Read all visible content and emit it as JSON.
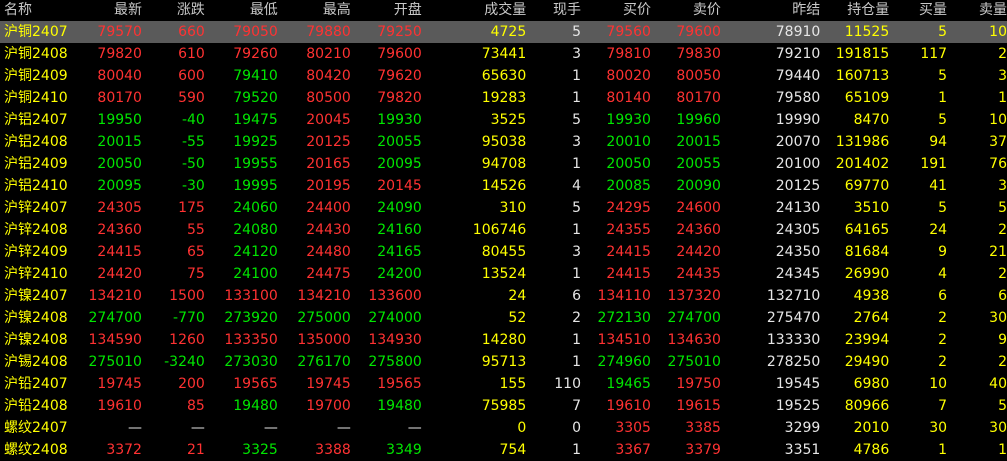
{
  "headers": [
    "名称",
    "最新",
    "涨跌",
    "最低",
    "最高",
    "开盘",
    "成交量",
    "现手",
    "买价",
    "卖价",
    "昨结",
    "持仓量",
    "买量",
    "卖量"
  ],
  "colors": {
    "up": "#ff3232",
    "down": "#00e600",
    "flat": "#e6e6e6",
    "volume": "#ffff00",
    "selected_row_bg": "#5a5a5a"
  },
  "rows": [
    {
      "name": "沪铜2407",
      "last": "79570",
      "chg": "660",
      "low": "79050",
      "high": "79880",
      "open": "79250",
      "vol": "4725",
      "cur": "5",
      "bid": "79560",
      "ask": "79600",
      "settle": "78910",
      "oi": "11525",
      "bidq": "5",
      "askq": "10",
      "dir": "up",
      "low_c": "red",
      "high_c": "red",
      "open_c": "red",
      "bid_c": "red",
      "ask_c": "red",
      "selected": true
    },
    {
      "name": "沪铜2408",
      "last": "79820",
      "chg": "610",
      "low": "79260",
      "high": "80210",
      "open": "79600",
      "vol": "73441",
      "cur": "3",
      "bid": "79810",
      "ask": "79830",
      "settle": "79210",
      "oi": "191815",
      "bidq": "117",
      "askq": "2",
      "dir": "up",
      "low_c": "red",
      "high_c": "red",
      "open_c": "red",
      "bid_c": "red",
      "ask_c": "red"
    },
    {
      "name": "沪铜2409",
      "last": "80040",
      "chg": "600",
      "low": "79410",
      "high": "80420",
      "open": "79620",
      "vol": "65630",
      "cur": "1",
      "bid": "80020",
      "ask": "80050",
      "settle": "79440",
      "oi": "160713",
      "bidq": "5",
      "askq": "3",
      "dir": "up",
      "low_c": "green",
      "high_c": "red",
      "open_c": "red",
      "bid_c": "red",
      "ask_c": "red"
    },
    {
      "name": "沪铜2410",
      "last": "80170",
      "chg": "590",
      "low": "79520",
      "high": "80500",
      "open": "79820",
      "vol": "19283",
      "cur": "1",
      "bid": "80140",
      "ask": "80170",
      "settle": "79580",
      "oi": "65109",
      "bidq": "1",
      "askq": "1",
      "dir": "up",
      "low_c": "green",
      "high_c": "red",
      "open_c": "red",
      "bid_c": "red",
      "ask_c": "red"
    },
    {
      "name": "沪铝2407",
      "last": "19950",
      "chg": "-40",
      "low": "19475",
      "high": "20045",
      "open": "19930",
      "vol": "3525",
      "cur": "5",
      "bid": "19930",
      "ask": "19960",
      "settle": "19990",
      "oi": "8470",
      "bidq": "5",
      "askq": "10",
      "dir": "down",
      "low_c": "green",
      "high_c": "red",
      "open_c": "green",
      "bid_c": "green",
      "ask_c": "green"
    },
    {
      "name": "沪铝2408",
      "last": "20015",
      "chg": "-55",
      "low": "19925",
      "high": "20125",
      "open": "20055",
      "vol": "95038",
      "cur": "3",
      "bid": "20010",
      "ask": "20015",
      "settle": "20070",
      "oi": "131986",
      "bidq": "94",
      "askq": "37",
      "dir": "down",
      "low_c": "green",
      "high_c": "red",
      "open_c": "green",
      "bid_c": "green",
      "ask_c": "green"
    },
    {
      "name": "沪铝2409",
      "last": "20050",
      "chg": "-50",
      "low": "19955",
      "high": "20165",
      "open": "20095",
      "vol": "94708",
      "cur": "1",
      "bid": "20050",
      "ask": "20055",
      "settle": "20100",
      "oi": "201402",
      "bidq": "191",
      "askq": "76",
      "dir": "down",
      "low_c": "green",
      "high_c": "red",
      "open_c": "green",
      "bid_c": "green",
      "ask_c": "green"
    },
    {
      "name": "沪铝2410",
      "last": "20095",
      "chg": "-30",
      "low": "19995",
      "high": "20195",
      "open": "20145",
      "vol": "14526",
      "cur": "4",
      "bid": "20085",
      "ask": "20090",
      "settle": "20125",
      "oi": "69770",
      "bidq": "41",
      "askq": "3",
      "dir": "down",
      "low_c": "green",
      "high_c": "red",
      "open_c": "red",
      "bid_c": "green",
      "ask_c": "green"
    },
    {
      "name": "沪锌2407",
      "last": "24305",
      "chg": "175",
      "low": "24060",
      "high": "24400",
      "open": "24090",
      "vol": "310",
      "cur": "5",
      "bid": "24295",
      "ask": "24600",
      "settle": "24130",
      "oi": "3510",
      "bidq": "5",
      "askq": "5",
      "dir": "up",
      "low_c": "green",
      "high_c": "red",
      "open_c": "green",
      "bid_c": "red",
      "ask_c": "red"
    },
    {
      "name": "沪锌2408",
      "last": "24360",
      "chg": "55",
      "low": "24080",
      "high": "24430",
      "open": "24160",
      "vol": "106746",
      "cur": "1",
      "bid": "24355",
      "ask": "24360",
      "settle": "24305",
      "oi": "64165",
      "bidq": "24",
      "askq": "2",
      "dir": "up",
      "low_c": "green",
      "high_c": "red",
      "open_c": "green",
      "bid_c": "red",
      "ask_c": "red"
    },
    {
      "name": "沪锌2409",
      "last": "24415",
      "chg": "65",
      "low": "24120",
      "high": "24480",
      "open": "24165",
      "vol": "80455",
      "cur": "3",
      "bid": "24415",
      "ask": "24420",
      "settle": "24350",
      "oi": "81684",
      "bidq": "9",
      "askq": "21",
      "dir": "up",
      "low_c": "green",
      "high_c": "red",
      "open_c": "green",
      "bid_c": "red",
      "ask_c": "red"
    },
    {
      "name": "沪锌2410",
      "last": "24420",
      "chg": "75",
      "low": "24100",
      "high": "24475",
      "open": "24200",
      "vol": "13524",
      "cur": "1",
      "bid": "24415",
      "ask": "24435",
      "settle": "24345",
      "oi": "26990",
      "bidq": "4",
      "askq": "2",
      "dir": "up",
      "low_c": "green",
      "high_c": "red",
      "open_c": "green",
      "bid_c": "red",
      "ask_c": "red"
    },
    {
      "name": "沪镍2407",
      "last": "134210",
      "chg": "1500",
      "low": "133100",
      "high": "134210",
      "open": "133600",
      "vol": "24",
      "cur": "6",
      "bid": "134110",
      "ask": "137320",
      "settle": "132710",
      "oi": "4938",
      "bidq": "6",
      "askq": "6",
      "dir": "up",
      "low_c": "red",
      "high_c": "red",
      "open_c": "red",
      "bid_c": "red",
      "ask_c": "red"
    },
    {
      "name": "沪镍2408",
      "last": "274700",
      "chg": "-770",
      "low": "273920",
      "high": "275000",
      "open": "274000",
      "vol": "52",
      "cur": "2",
      "bid": "272130",
      "ask": "274700",
      "settle": "275470",
      "oi": "2764",
      "bidq": "2",
      "askq": "30",
      "dir": "down",
      "low_c": "green",
      "high_c": "green",
      "open_c": "green",
      "bid_c": "green",
      "ask_c": "green"
    },
    {
      "name": "沪镍2408",
      "last": "134590",
      "chg": "1260",
      "low": "133350",
      "high": "135000",
      "open": "134930",
      "vol": "14280",
      "cur": "1",
      "bid": "134510",
      "ask": "134630",
      "settle": "133330",
      "oi": "23994",
      "bidq": "2",
      "askq": "9",
      "dir": "up",
      "low_c": "red",
      "high_c": "red",
      "open_c": "red",
      "bid_c": "red",
      "ask_c": "red"
    },
    {
      "name": "沪锡2408",
      "last": "275010",
      "chg": "-3240",
      "low": "273030",
      "high": "276170",
      "open": "275800",
      "vol": "95713",
      "cur": "1",
      "bid": "274960",
      "ask": "275010",
      "settle": "278250",
      "oi": "29490",
      "bidq": "2",
      "askq": "2",
      "dir": "down",
      "low_c": "green",
      "high_c": "green",
      "open_c": "green",
      "bid_c": "green",
      "ask_c": "green"
    },
    {
      "name": "沪铅2407",
      "last": "19745",
      "chg": "200",
      "low": "19565",
      "high": "19745",
      "open": "19565",
      "vol": "155",
      "cur": "110",
      "bid": "19465",
      "ask": "19750",
      "settle": "19545",
      "oi": "6980",
      "bidq": "10",
      "askq": "40",
      "dir": "up",
      "low_c": "red",
      "high_c": "red",
      "open_c": "red",
      "bid_c": "green",
      "ask_c": "red"
    },
    {
      "name": "沪铅2408",
      "last": "19610",
      "chg": "85",
      "low": "19480",
      "high": "19700",
      "open": "19480",
      "vol": "75985",
      "cur": "7",
      "bid": "19610",
      "ask": "19615",
      "settle": "19525",
      "oi": "80966",
      "bidq": "7",
      "askq": "5",
      "dir": "up",
      "low_c": "green",
      "high_c": "red",
      "open_c": "green",
      "bid_c": "red",
      "ask_c": "red"
    },
    {
      "name": "螺纹2407",
      "last": "—",
      "chg": "—",
      "low": "—",
      "high": "—",
      "open": "—",
      "vol": "0",
      "cur": "0",
      "bid": "3305",
      "ask": "3385",
      "settle": "3299",
      "oi": "2010",
      "bidq": "30",
      "askq": "30",
      "dir": "flat",
      "low_c": "white",
      "high_c": "white",
      "open_c": "white",
      "bid_c": "red",
      "ask_c": "red"
    },
    {
      "name": "螺纹2408",
      "last": "3372",
      "chg": "21",
      "low": "3325",
      "high": "3388",
      "open": "3349",
      "vol": "754",
      "cur": "1",
      "bid": "3367",
      "ask": "3379",
      "settle": "3351",
      "oi": "4786",
      "bidq": "1",
      "askq": "1",
      "dir": "up",
      "low_c": "green",
      "high_c": "red",
      "open_c": "green",
      "bid_c": "red",
      "ask_c": "red"
    }
  ]
}
